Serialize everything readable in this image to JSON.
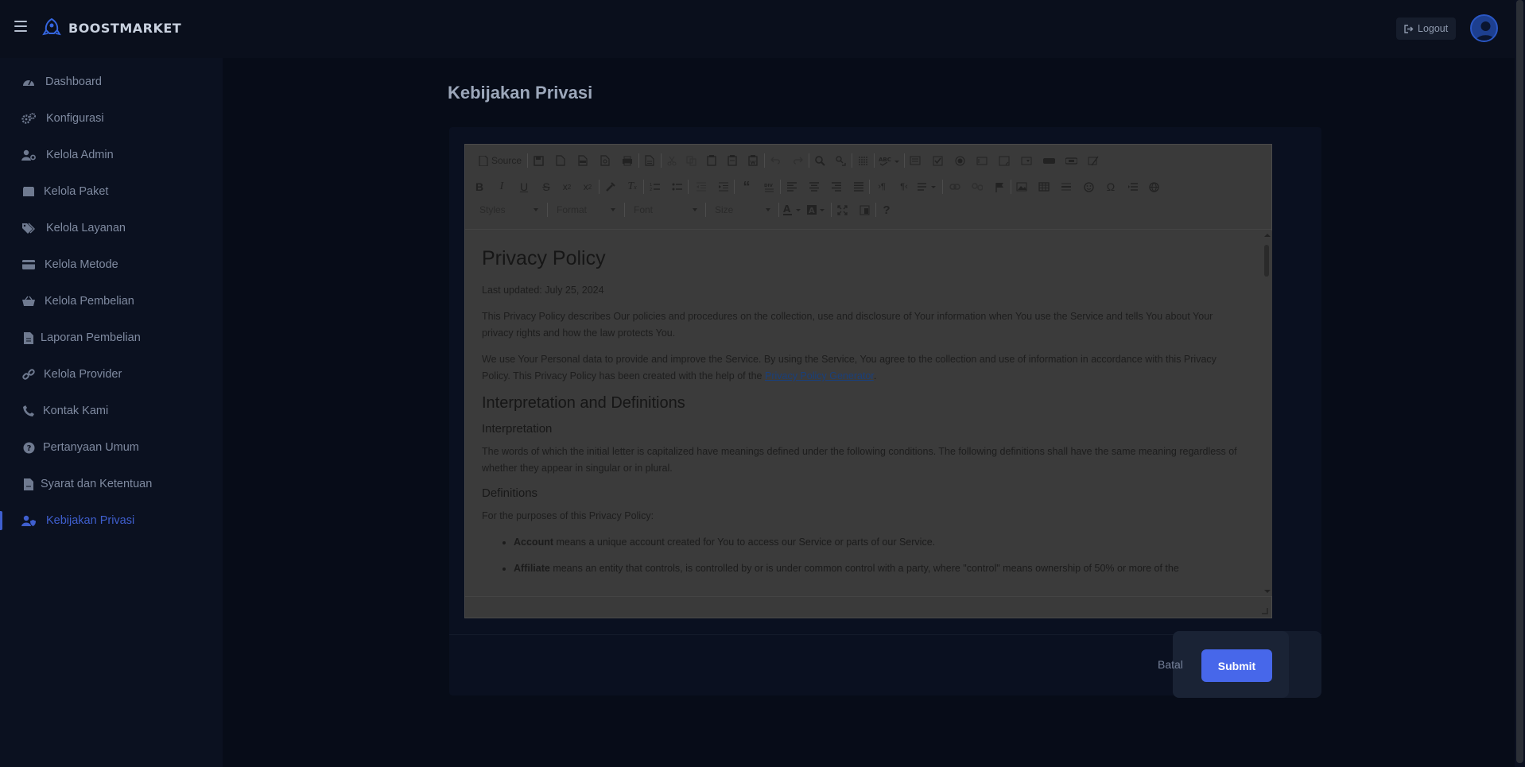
{
  "app": {
    "name": "BOOSTMARKET"
  },
  "header": {
    "logout_label": "Logout"
  },
  "sidebar": {
    "items": [
      {
        "label": "Dashboard",
        "icon": "dashboard-icon"
      },
      {
        "label": "Konfigurasi",
        "icon": "gears-icon"
      },
      {
        "label": "Kelola Admin",
        "icon": "user-gear-icon"
      },
      {
        "label": "Kelola Paket",
        "icon": "box-icon"
      },
      {
        "label": "Kelola Layanan",
        "icon": "tags-icon"
      },
      {
        "label": "Kelola Metode",
        "icon": "credit-card-icon"
      },
      {
        "label": "Kelola Pembelian",
        "icon": "basket-icon"
      },
      {
        "label": "Laporan Pembelian",
        "icon": "file-icon"
      },
      {
        "label": "Kelola Provider",
        "icon": "link-icon"
      },
      {
        "label": "Kontak Kami",
        "icon": "phone-icon"
      },
      {
        "label": "Pertanyaan Umum",
        "icon": "question-circle-icon"
      },
      {
        "label": "Syarat dan Ketentuan",
        "icon": "file-contract-icon"
      },
      {
        "label": "Kebijakan Privasi",
        "icon": "user-shield-icon",
        "active": true
      }
    ]
  },
  "page": {
    "title": "Kebijakan Privasi"
  },
  "editor": {
    "toolbar": {
      "source_label": "Source",
      "styles_label": "Styles",
      "format_label": "Format",
      "font_label": "Font",
      "size_label": "Size",
      "help_label": "?"
    },
    "content": {
      "h1": "Privacy Policy",
      "last_updated": "Last updated: July 25, 2024",
      "p1": "This Privacy Policy describes Our policies and procedures on the collection, use and disclosure of Your information when You use the Service and tells You about Your privacy rights and how the law protects You.",
      "p2_before": "We use Your Personal data to provide and improve the Service. By using the Service, You agree to the collection and use of information in accordance with this Privacy Policy. This Privacy Policy has been created with the help of the ",
      "p2_link": "Privacy Policy Generator",
      "p2_after": ".",
      "h2": "Interpretation and Definitions",
      "h3_interp": "Interpretation",
      "p3": "The words of which the initial letter is capitalized have meanings defined under the following conditions. The following definitions shall have the same meaning regardless of whether they appear in singular or in plural.",
      "h3_def": "Definitions",
      "p4": "For the purposes of this Privacy Policy:",
      "li1_term": "Account",
      "li1_text": " means a unique account created for You to access our Service or parts of our Service.",
      "li2_term": "Affiliate",
      "li2_text": " means an entity that controls, is controlled by or is under common control with a party, where \"control\" means ownership of 50% or more of the"
    }
  },
  "actions": {
    "cancel_label": "Batal",
    "submit_label": "Submit"
  },
  "colors": {
    "accent": "#4767ea",
    "active_nav": "#3f5fcf",
    "background": "#070c18"
  }
}
